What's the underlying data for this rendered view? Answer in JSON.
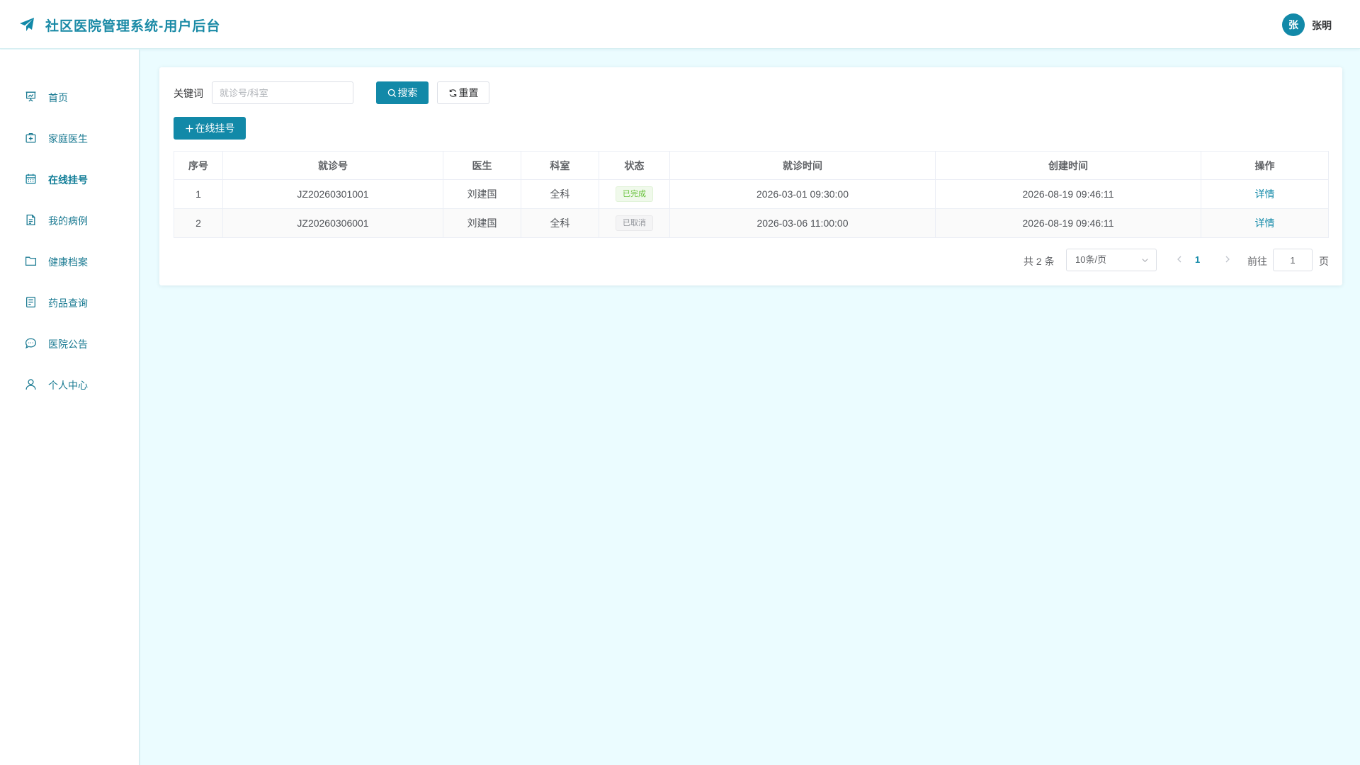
{
  "header": {
    "title": "社区医院管理系统-用户后台",
    "avatar_text": "张",
    "user_name": "张明",
    "accent_color": "#1289a8"
  },
  "sidebar": {
    "items": [
      {
        "label": "首页",
        "icon": "presentation-board-icon"
      },
      {
        "label": "家庭医生",
        "icon": "medical-kit-icon"
      },
      {
        "label": "在线挂号",
        "icon": "calendar-icon",
        "active": true
      },
      {
        "label": "我的病例",
        "icon": "document-icon"
      },
      {
        "label": "健康档案",
        "icon": "folder-icon"
      },
      {
        "label": "药品查询",
        "icon": "list-document-icon"
      },
      {
        "label": "医院公告",
        "icon": "chat-bubble-icon"
      },
      {
        "label": "个人中心",
        "icon": "user-icon"
      }
    ]
  },
  "search": {
    "label": "关键词",
    "placeholder": "就诊号/科室",
    "value": "",
    "search_button": "搜索",
    "reset_button": "重置"
  },
  "toolbar": {
    "add_button": "在线挂号"
  },
  "table": {
    "columns": [
      "序号",
      "就诊号",
      "医生",
      "科室",
      "状态",
      "就诊时间",
      "创建时间",
      "操作"
    ],
    "rows": [
      {
        "index": "1",
        "visit_no": "JZ20260301001",
        "doctor": "刘建国",
        "dept": "全科",
        "status": "已完成",
        "status_type": "success",
        "visit_time": "2026-03-01 09:30:00",
        "created_time": "2026-08-19 09:46:11",
        "action": "详情"
      },
      {
        "index": "2",
        "visit_no": "JZ20260306001",
        "doctor": "刘建国",
        "dept": "全科",
        "status": "已取消",
        "status_type": "info",
        "visit_time": "2026-03-06 11:00:00",
        "created_time": "2026-08-19 09:46:11",
        "action": "详情"
      }
    ]
  },
  "pagination": {
    "total_text": "共 2 条",
    "page_size": "10条/页",
    "current_page": "1",
    "goto_label": "前往",
    "goto_value": "1",
    "page_suffix": "页"
  }
}
